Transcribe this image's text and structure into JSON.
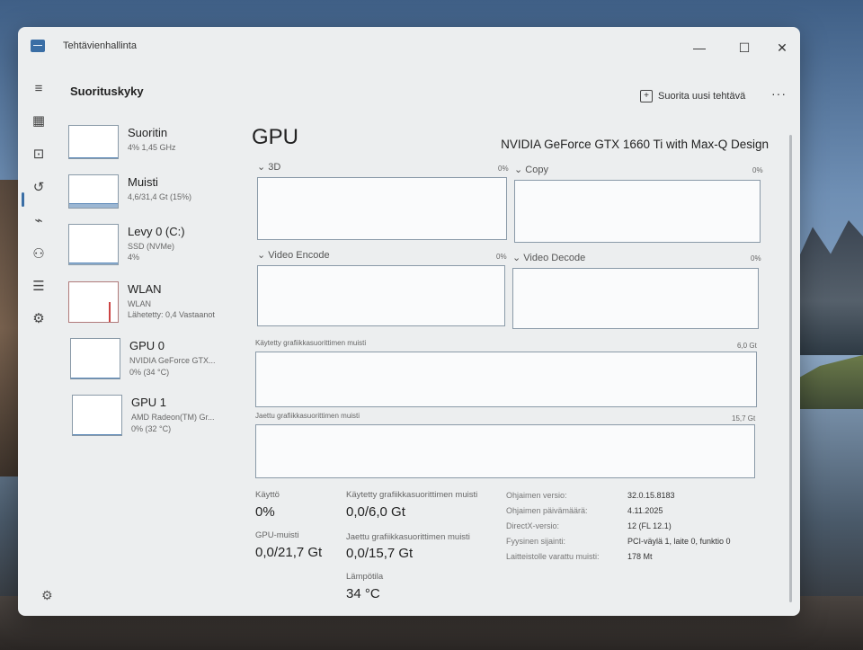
{
  "window": {
    "app_title": "Tehtävienhallinta",
    "minimize": "—",
    "maximize": "☐",
    "close": "✕"
  },
  "header": {
    "page_title": "Suorituskyky",
    "run_task_label": "Suorita uusi tehtävä",
    "more": "···"
  },
  "nav": {
    "icons": [
      "hamburger-icon",
      "processes-icon",
      "performance-icon",
      "app-history-icon",
      "startup-apps-icon",
      "users-icon",
      "details-icon",
      "services-icon",
      "settings-icon"
    ]
  },
  "perf_items": [
    {
      "name": "Suoritin",
      "sub1": "4% 1,45 GHz",
      "sub2": "",
      "level": 0.04
    },
    {
      "name": "Muisti",
      "sub1": "4,6/31,4 Gt (15%)",
      "sub2": "",
      "level": 0.15
    },
    {
      "name": "Levy 0 (C:)",
      "sub1": "SSD (NVMe)",
      "sub2": "4%",
      "level": 0.04
    },
    {
      "name": "WLAN",
      "sub1": "WLAN",
      "sub2": "Lähetetty: 0,4 Vastaanot",
      "level": 0.0
    },
    {
      "name": "GPU 0",
      "sub1": "NVIDIA GeForce GTX...",
      "sub2": "0% (34 °C)",
      "level": 0.0
    },
    {
      "name": "GPU 1",
      "sub1": "AMD Radeon(TM) Gr...",
      "sub2": "0% (32 °C)",
      "level": 0.0
    }
  ],
  "gpu": {
    "title": "GPU",
    "model": "NVIDIA GeForce GTX 1660 Ti with Max-Q Design",
    "engines": [
      {
        "label": "3D",
        "pct": "0%"
      },
      {
        "label": "Copy",
        "pct": "0%"
      },
      {
        "label": "Video Encode",
        "pct": "0%"
      },
      {
        "label": "Video Decode",
        "pct": "0%"
      }
    ],
    "dedicated_mem_label": "Käytetty grafiikkasuorittimen muisti",
    "dedicated_mem_max": "6,0 Gt",
    "shared_mem_label": "Jaettu grafiikkasuorittimen muisti",
    "shared_mem_max": "15,7 Gt"
  },
  "stats": {
    "usage_label": "Käyttö",
    "usage_value": "0%",
    "gpu_mem_label": "GPU-muisti",
    "gpu_mem_value": "0,0/21,7 Gt",
    "dedicated_label": "Käytetty grafiikkasuorittimen muisti",
    "dedicated_value": "0,0/6,0 Gt",
    "shared_label": "Jaettu grafiikkasuorittimen muisti",
    "shared_value": "0,0/15,7 Gt",
    "temp_label": "Lämpötila",
    "temp_value": "34 °C"
  },
  "properties": [
    {
      "label": "Ohjaimen versio:",
      "value": "32.0.15.8183"
    },
    {
      "label": "Ohjaimen päivämäärä:",
      "value": "4.11.2025"
    },
    {
      "label": "DirectX-versio:",
      "value": "12 (FL 12.1)"
    },
    {
      "label": "Fyysinen sijainti:",
      "value": "PCI-väylä 1, laite 0, funktio 0"
    },
    {
      "label": "Laitteistolle varattu muisti:",
      "value": "178 Mt"
    }
  ]
}
